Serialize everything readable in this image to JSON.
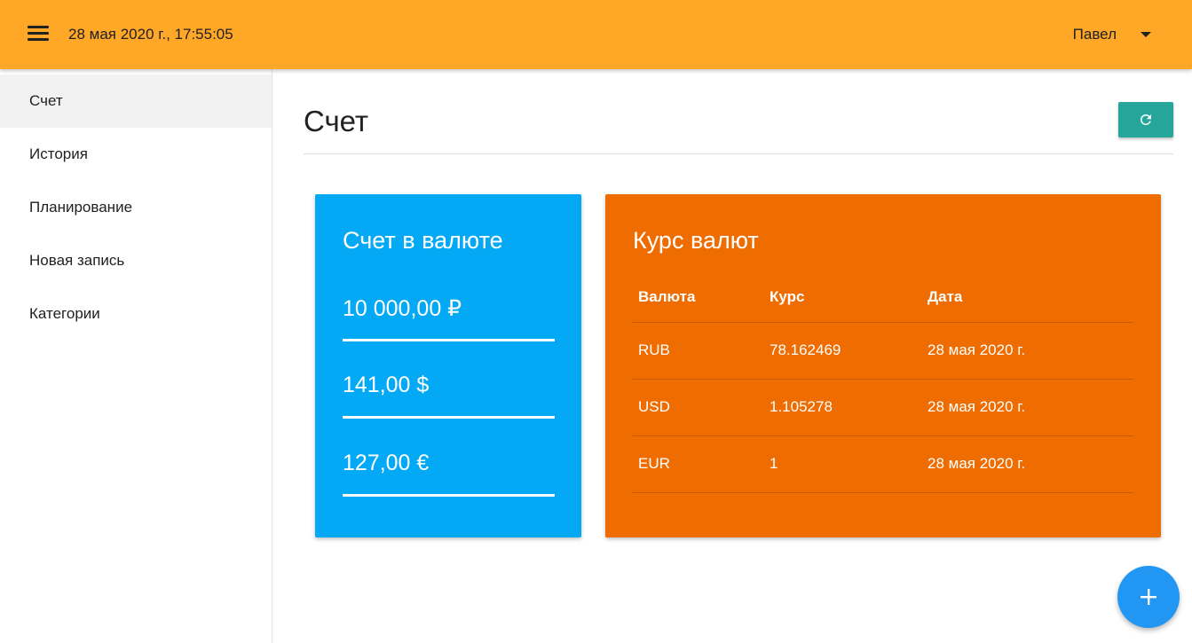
{
  "header": {
    "datetime": "28 мая 2020 г., 17:55:05",
    "user_name": "Павел",
    "menu_icon": "hamburger-icon",
    "dropdown_icon": "caret-down-icon"
  },
  "sidebar": {
    "items": [
      {
        "label": "Счет",
        "active": true
      },
      {
        "label": "История",
        "active": false
      },
      {
        "label": "Планирование",
        "active": false
      },
      {
        "label": "Новая запись",
        "active": false
      },
      {
        "label": "Категории",
        "active": false
      }
    ]
  },
  "page": {
    "title": "Счет",
    "refresh_icon": "refresh-icon"
  },
  "balance_card": {
    "title": "Счет в валюте",
    "amounts": [
      "10 000,00 ₽",
      "141,00 $",
      "127,00 €"
    ],
    "color": "#03a9f4"
  },
  "rates_card": {
    "title": "Курс валют",
    "columns": [
      "Валюта",
      "Курс",
      "Дата"
    ],
    "rows": [
      {
        "currency": "RUB",
        "rate": "78.162469",
        "date": "28 мая 2020 г."
      },
      {
        "currency": "USD",
        "rate": "1.105278",
        "date": "28 мая 2020 г."
      },
      {
        "currency": "EUR",
        "rate": "1",
        "date": "28 мая 2020 г."
      }
    ],
    "color": "#ef6c00"
  },
  "fab": {
    "icon": "plus-icon"
  },
  "colors": {
    "navbar": "#ffa726",
    "refresh_button": "#26a69a",
    "fab": "#2196f3"
  }
}
